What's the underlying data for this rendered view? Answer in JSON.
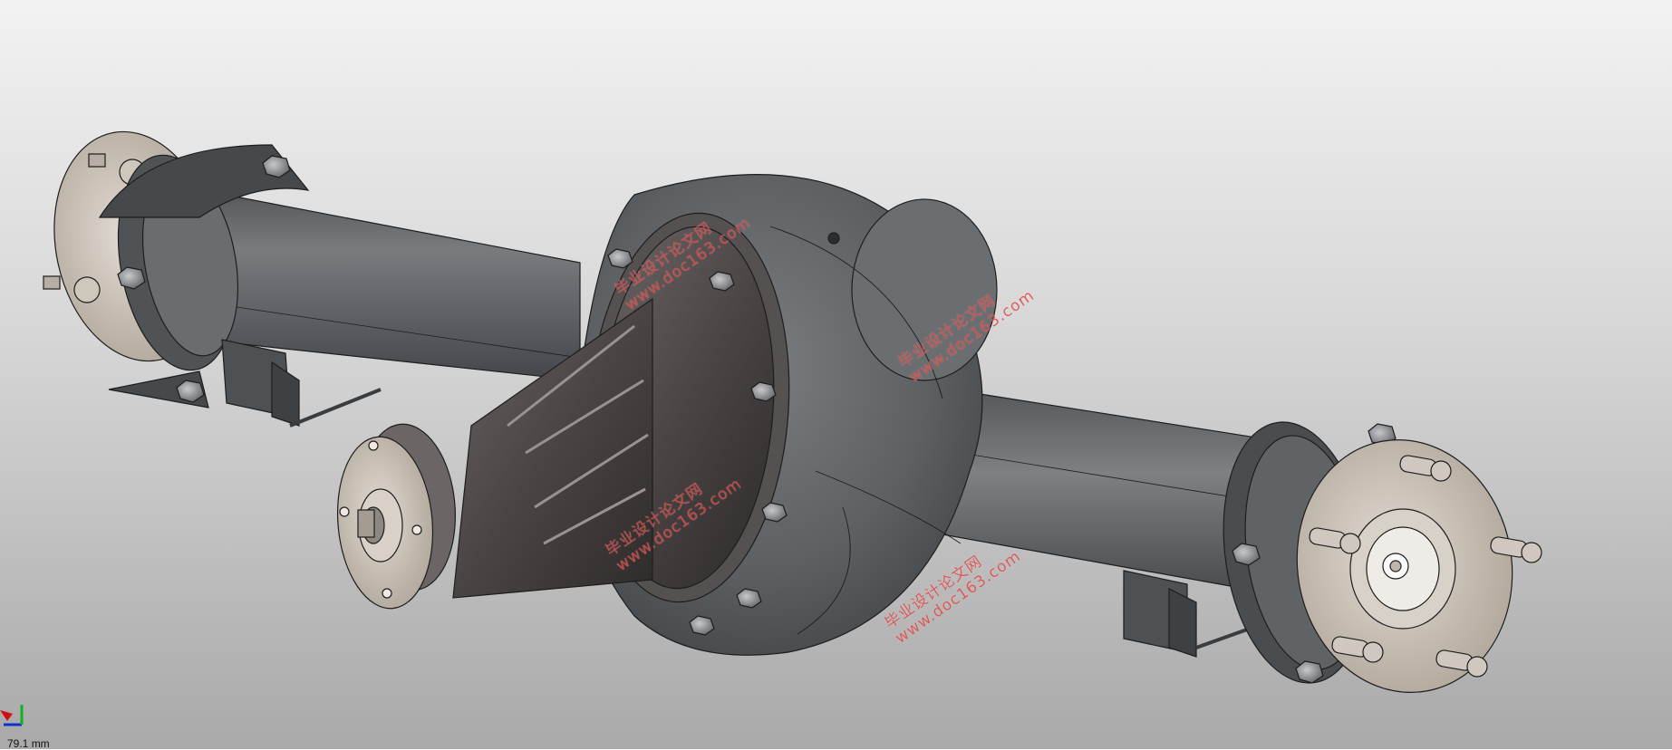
{
  "viewport": {
    "background_top": "#f2f2f2",
    "background_bottom": "#a9a9a9",
    "scale_label": "79.1 mm"
  },
  "model": {
    "body_color": "#5e6164",
    "dark_color": "#3e4144",
    "carrier_color": "#4a4545",
    "flange_color": "#c9c0b6",
    "outline_color": "#1d1d1d"
  },
  "watermarks": [
    {
      "line1": "毕业设计论文网",
      "line2": "www.doc163.com"
    },
    {
      "line1": "毕业设计论文网",
      "line2": "www.doc163.com"
    },
    {
      "line1": "毕业设计论文网",
      "line2": "www.doc163.com"
    },
    {
      "line1": "毕业设计论文网",
      "line2": "www.doc163.com"
    }
  ],
  "triad_icons": [
    "x-axis-red",
    "y-axis-green",
    "z-axis-blue"
  ]
}
